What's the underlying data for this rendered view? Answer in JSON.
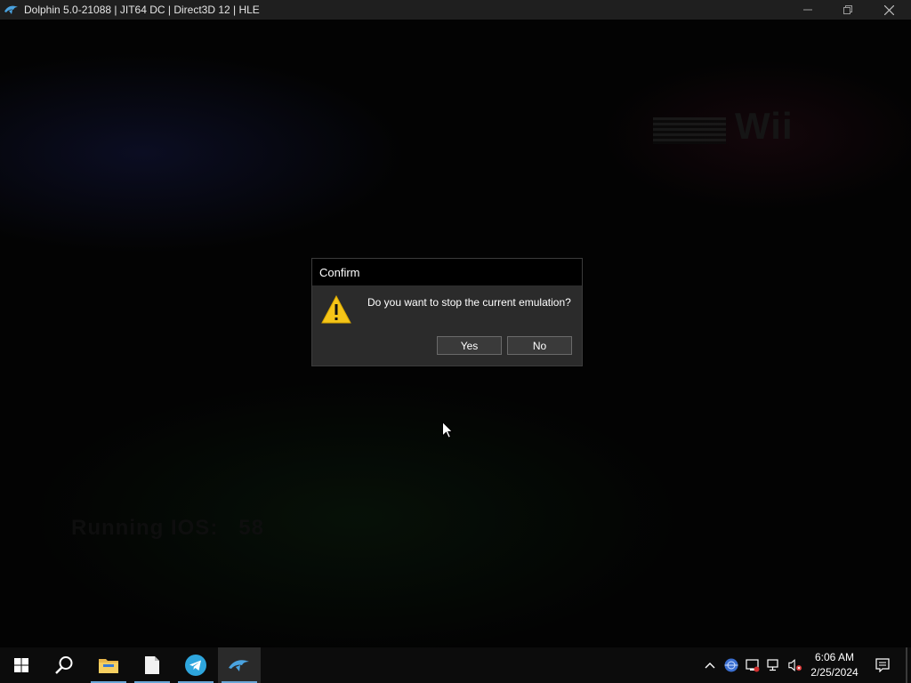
{
  "window": {
    "title": "Dolphin 5.0-21088 | JIT64 DC | Direct3D 12 | HLE",
    "icon": "dolphin-icon"
  },
  "render": {
    "wii_logo": "Wii",
    "running_ios": "Running IOS:   58"
  },
  "dialog": {
    "title": "Confirm",
    "message": "Do you want to stop the current emulation?",
    "icon": "warning-icon",
    "yes_label": "Yes",
    "no_label": "No"
  },
  "taskbar": {
    "items": [
      "start-icon",
      "search-icon",
      "file-explorer-icon",
      "notepad-icon",
      "telegram-icon",
      "dolphin-icon"
    ],
    "clock": {
      "time": "6:06 AM",
      "date": "2/25/2024"
    }
  },
  "colors": {
    "dialog_bg": "#2b2b2b",
    "warning_yellow": "#f5c518",
    "accent_underline": "#6aa7d8"
  }
}
